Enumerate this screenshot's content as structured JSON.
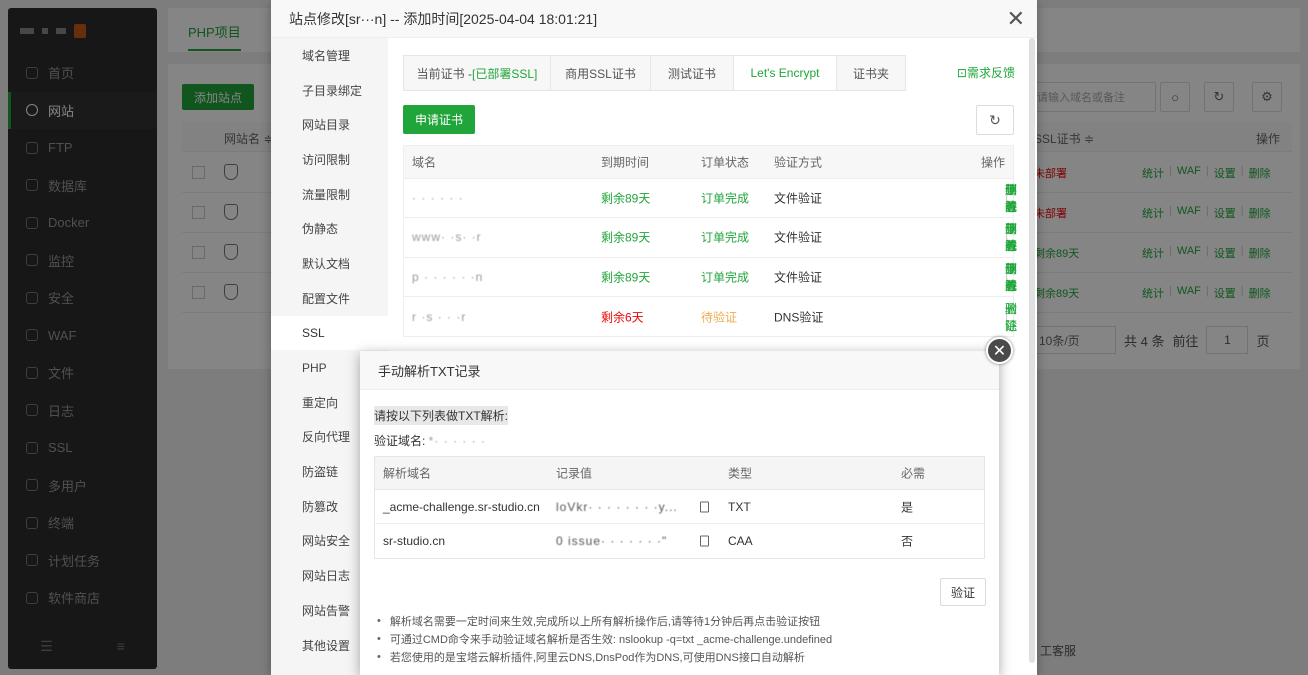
{
  "sidebar": {
    "items": [
      {
        "label": "首页",
        "icon": "home-icon"
      },
      {
        "label": "网站",
        "icon": "globe-icon",
        "active": true
      },
      {
        "label": "FTP",
        "icon": "ftp-icon"
      },
      {
        "label": "数据库",
        "icon": "database-icon"
      },
      {
        "label": "Docker",
        "icon": "docker-icon"
      },
      {
        "label": "监控",
        "icon": "monitor-icon"
      },
      {
        "label": "安全",
        "icon": "shield-icon"
      },
      {
        "label": "WAF",
        "icon": "waf-icon"
      },
      {
        "label": "文件",
        "icon": "folder-icon"
      },
      {
        "label": "日志",
        "icon": "log-icon"
      },
      {
        "label": "SSL",
        "icon": "ssl-icon"
      },
      {
        "label": "多用户",
        "icon": "users-icon"
      },
      {
        "label": "终端",
        "icon": "terminal-icon"
      },
      {
        "label": "计划任务",
        "icon": "schedule-icon"
      },
      {
        "label": "软件商店",
        "icon": "store-icon"
      }
    ]
  },
  "topbar": {
    "tab": "PHP项目"
  },
  "bg": {
    "add_site": "添加站点",
    "search_placeholder": "请输入域名或备注",
    "col_site": "网站名 ≑",
    "col_ssl": "SSL证书 ≑",
    "col_ops": "操作",
    "rows": [
      {
        "ssl": "未部署",
        "ssl_color": "#ef0808"
      },
      {
        "ssl": "未部署",
        "ssl_color": "#ef0808"
      },
      {
        "ssl": "剩余89天",
        "ssl_color": "#20a53a"
      },
      {
        "ssl": "剩余89天",
        "ssl_color": "#20a53a"
      }
    ],
    "row_ops": [
      "统计",
      "WAF",
      "设置",
      "删除"
    ],
    "pager_size": "10条/页",
    "pager_total": "共 4 条",
    "pager_goto": "前往",
    "pager_page": "1",
    "pager_unit": "页",
    "kefu": "工客服"
  },
  "site_dialog": {
    "title": "站点修改[sr···n] -- 添加时间[2025-04-04 18:01:21]",
    "menu": [
      "域名管理",
      "子目录绑定",
      "网站目录",
      "访问限制",
      "流量限制",
      "伪静态",
      "默认文档",
      "配置文件",
      "SSL",
      "PHP",
      "重定向",
      "反向代理",
      "防盗链",
      "防篡改",
      "网站安全",
      "网站日志",
      "网站告警",
      "其他设置"
    ],
    "menu_active": 8,
    "tabs": {
      "current_prefix": "当前证书 - ",
      "current_status": "[已部署SSL]",
      "commercial": "商用SSL证书",
      "test": "测试证书",
      "letsencrypt": "Let's Encrypt",
      "folder": "证书夹"
    },
    "feedback": "需求反馈",
    "apply_button": "申请证书",
    "table": {
      "headers": {
        "domain": "域名",
        "expire": "到期时间",
        "status": "订单状态",
        "method": "验证方式",
        "ops": "操作"
      },
      "rows": [
        {
          "domain": "·  · · · · ·",
          "expire": "剩余89天",
          "expire_color": "#20a53a",
          "status": "订单完成",
          "status_color": "#20a53a",
          "method": "文件验证",
          "ops": [
            "部署",
            "下载",
            "续签",
            "删除"
          ]
        },
        {
          "domain": "www· ·s· ·r",
          "expire": "剩余89天",
          "expire_color": "#20a53a",
          "status": "订单完成",
          "status_color": "#20a53a",
          "method": "文件验证",
          "ops": [
            "部署",
            "下载",
            "续签",
            "删除"
          ]
        },
        {
          "domain": "p · ·  · · · ·n",
          "expire": "剩余89天",
          "expire_color": "#20a53a",
          "status": "订单完成",
          "status_color": "#20a53a",
          "method": "文件验证",
          "ops": [
            "部署",
            "下载",
            "续签",
            "删除"
          ]
        },
        {
          "domain": "r ·s · · ·r",
          "expire": "剩余6天",
          "expire_color": "#ef0808",
          "status": "待验证",
          "status_color": "#f0ad4e",
          "method": "DNS验证",
          "ops": [
            "验证",
            "删除"
          ]
        }
      ]
    }
  },
  "txt_dialog": {
    "title": "手动解析TXT记录",
    "tip": "请按以下列表做TXT解析:",
    "verify_domain_label": "验证域名: ",
    "verify_domain_value": "*· · · · · ·",
    "headers": {
      "name": "解析域名",
      "value": "记录值",
      "type": "类型",
      "required": "必需"
    },
    "rows": [
      {
        "name": "_acme-challenge.sr-studio.cn",
        "value": "loVkr· · · · · · · ·y...",
        "type": "TXT",
        "required": "是"
      },
      {
        "name": "sr-studio.cn",
        "value": "0 issue· · · · · · ·\"",
        "type": "CAA",
        "required": "否"
      }
    ],
    "verify_button": "验证",
    "notes": [
      "解析域名需要一定时间来生效,完成所以上所有解析操作后,请等待1分钟后再点击验证按钮",
      "可通过CMD命令来手动验证域名解析是否生效: nslookup -q=txt _acme-challenge.undefined",
      "若您使用的是宝塔云解析插件,阿里云DNS,DnsPod作为DNS,可使用DNS接口自动解析"
    ]
  }
}
